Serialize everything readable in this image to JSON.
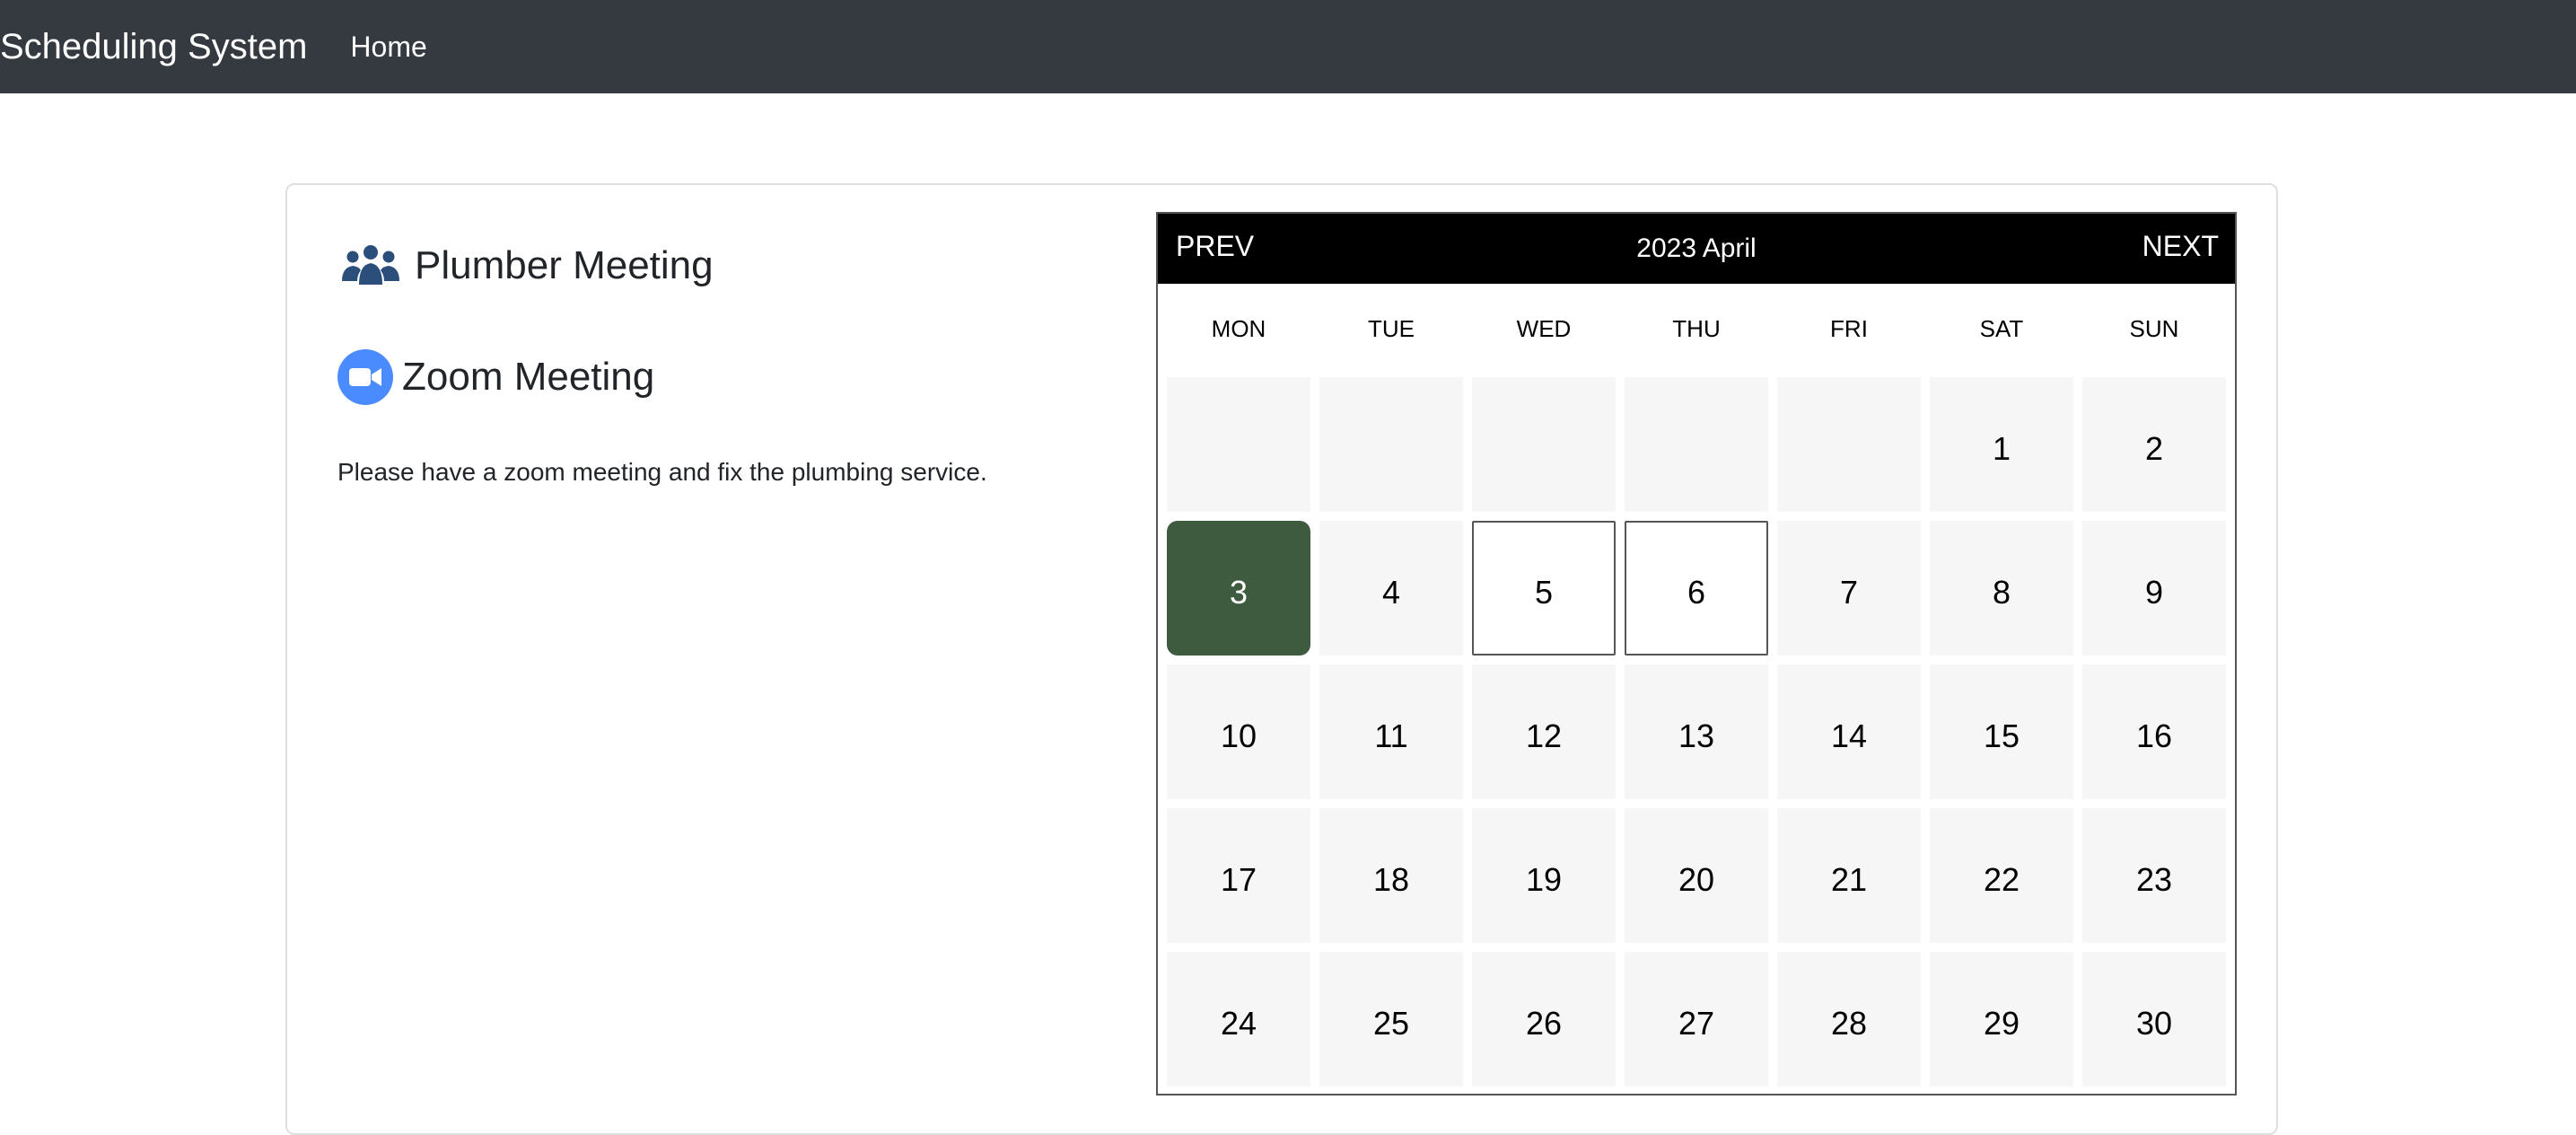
{
  "navbar": {
    "brand": "Scheduling System",
    "home_link": "Home"
  },
  "event": {
    "title": "Plumber Meeting",
    "icon": "people-group-icon",
    "location_type": "Zoom Meeting",
    "location_icon": "video-camera-icon",
    "description": "Please have a zoom meeting and fix the plumbing service."
  },
  "calendar": {
    "prev_label": "PREV",
    "next_label": "NEXT",
    "month_label": "2023 April",
    "weekdays": [
      "MON",
      "TUE",
      "WED",
      "THU",
      "FRI",
      "SAT",
      "SUN"
    ],
    "leading_blanks": 5,
    "days": [
      "1",
      "2",
      "3",
      "4",
      "5",
      "6",
      "7",
      "8",
      "9",
      "10",
      "11",
      "12",
      "13",
      "14",
      "15",
      "16",
      "17",
      "18",
      "19",
      "20",
      "21",
      "22",
      "23",
      "24",
      "25",
      "26",
      "27",
      "28",
      "29",
      "30"
    ],
    "selected_day": "3",
    "available_days": [
      "5",
      "6"
    ]
  },
  "colors": {
    "navbar_bg": "#343a40",
    "calendar_header_bg": "#000000",
    "selected_day_bg": "#3e5a3f",
    "day_cell_bg": "#f6f6f6",
    "zoom_blue": "#4a8cff",
    "people_icon": "#2c4e7a"
  }
}
